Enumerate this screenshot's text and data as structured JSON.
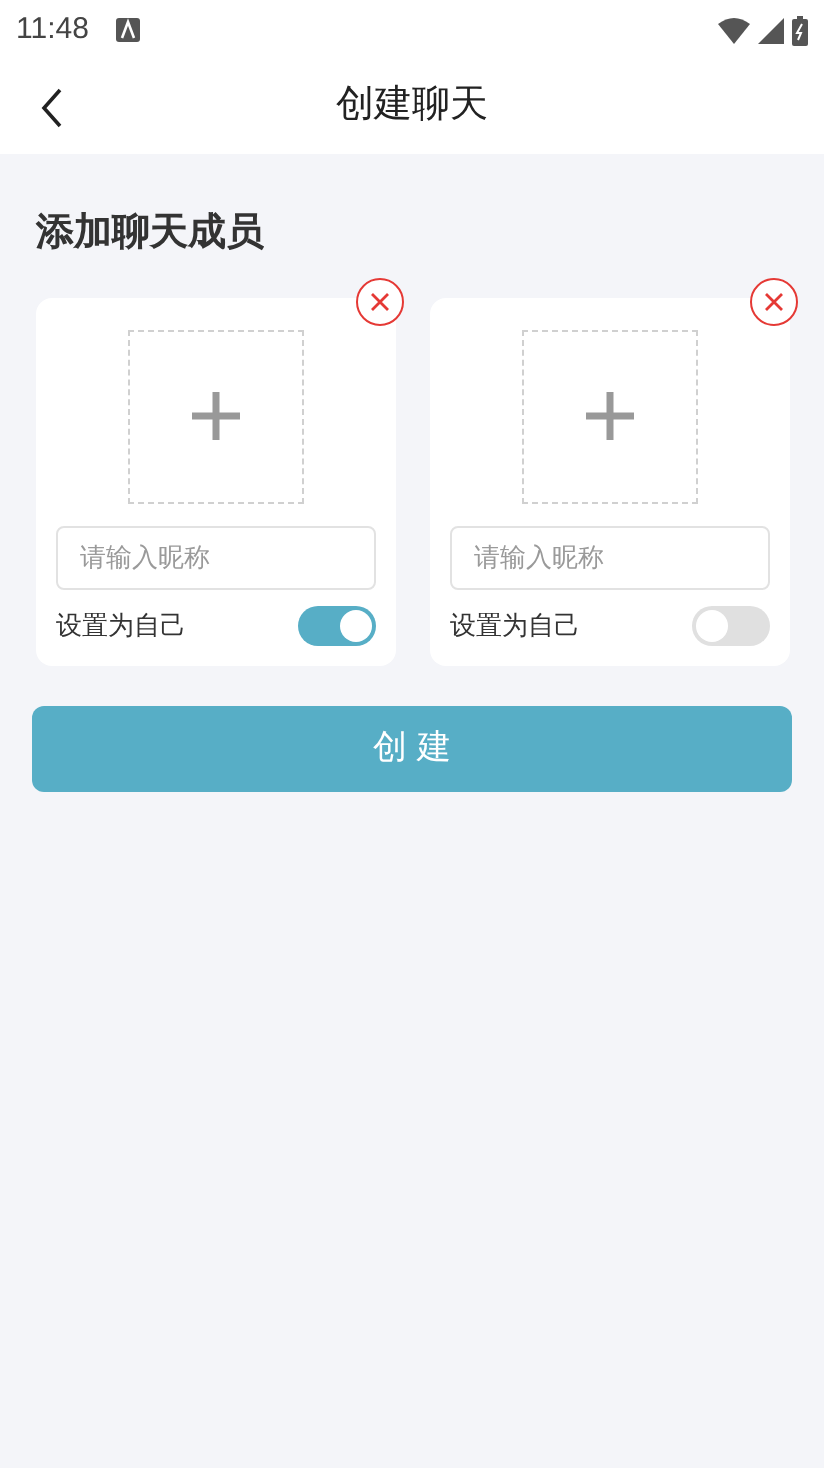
{
  "status_bar": {
    "time": "11:48"
  },
  "header": {
    "title": "创建聊天"
  },
  "section": {
    "title": "添加聊天成员"
  },
  "members": [
    {
      "placeholder": "请输入昵称",
      "self_label": "设置为自己",
      "on": true
    },
    {
      "placeholder": "请输入昵称",
      "self_label": "设置为自己",
      "on": false
    }
  ],
  "create_button": {
    "label": "创 建"
  }
}
